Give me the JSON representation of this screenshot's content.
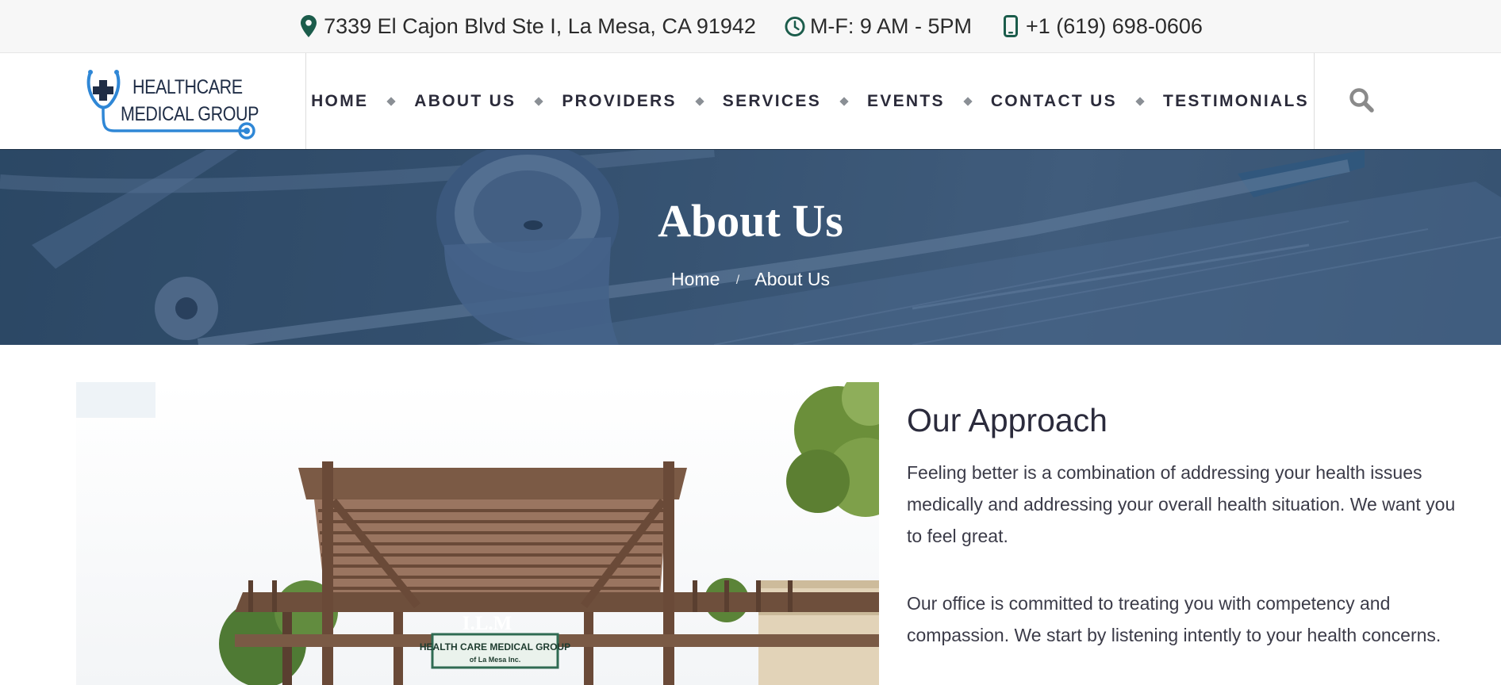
{
  "topbar": {
    "address": "7339 El Cajon Blvd Ste I, La Mesa, CA 91942",
    "hours": "M-F: 9 AM - 5PM",
    "phone": "+1 (619) 698-0606",
    "icons": [
      "map-pin-icon",
      "clock-icon",
      "mobile-phone-icon"
    ],
    "icon_color": "#1b5c4b"
  },
  "logo": {
    "line1": "HEALTHCARE",
    "line2": "MEDICAL GROUP",
    "accent_color": "#2f87d6",
    "text_color": "#1f2d46"
  },
  "nav": {
    "items": [
      "HOME",
      "ABOUT US",
      "PROVIDERS",
      "SERVICES",
      "EVENTS",
      "CONTACT US",
      "TESTIMONIALS"
    ],
    "search_icon": "search-icon"
  },
  "hero": {
    "title": "About Us",
    "breadcrumb": {
      "home": "Home",
      "separator": "/",
      "current": "About Us"
    },
    "overlay_color": "#2f4b68"
  },
  "building": {
    "sign_top": "I.L.M",
    "sign_main": "HEALTH CARE MEDICAL GROUP",
    "sign_sub": "of La Mesa Inc."
  },
  "approach": {
    "heading": "Our Approach",
    "paragraph1": "Feeling better is a combination of addressing your health issues medically and addressing your overall health situation. We want you to feel great.",
    "paragraph2": "Our office is committed to treating you with competency and compassion. We start by listening intently to your health concerns."
  }
}
